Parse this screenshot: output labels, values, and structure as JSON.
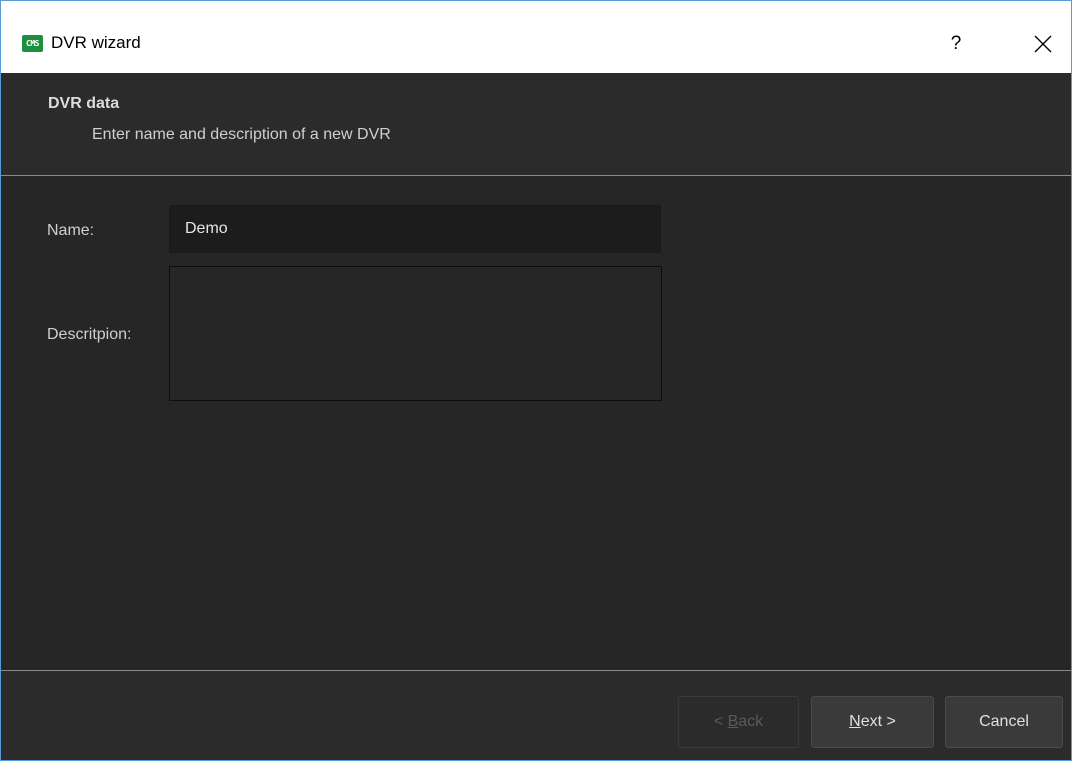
{
  "window": {
    "title": "DVR wizard",
    "app_icon_text": "CMS",
    "help_label": "?",
    "close_icon": "close-icon"
  },
  "header": {
    "title": "DVR data",
    "subtitle": "Enter name and description of a new DVR"
  },
  "form": {
    "name_label": "Name:",
    "name_value": "Demo",
    "description_label": "Descritpion:",
    "description_value": ""
  },
  "buttons": {
    "back": {
      "prefix": "< ",
      "mnemonic": "B",
      "rest": "ack",
      "enabled": false
    },
    "next": {
      "prefix": "",
      "mnemonic": "N",
      "rest": "ext >",
      "enabled": true
    },
    "cancel": {
      "label": "Cancel",
      "enabled": true
    }
  },
  "colors": {
    "accent_border": "#5b9bd5",
    "app_icon": "#1f8f3f",
    "background": "#262626"
  }
}
